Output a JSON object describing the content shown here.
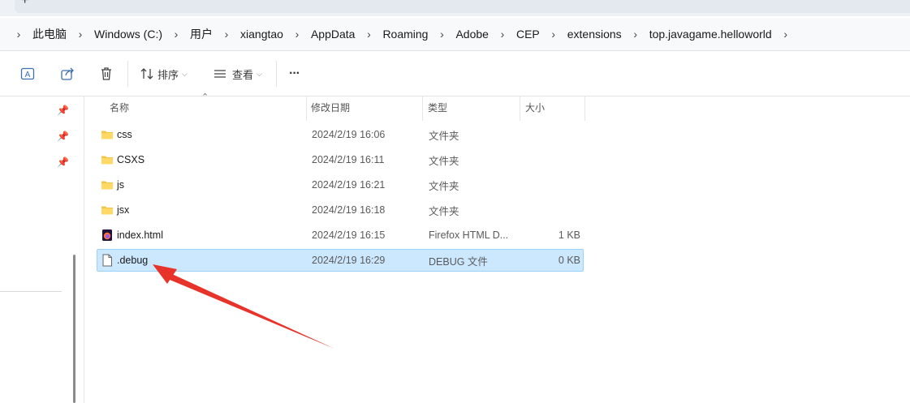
{
  "tabbar": {
    "new_tab_glyph": "+"
  },
  "breadcrumb": {
    "items": [
      "此电脑",
      "Windows (C:)",
      "用户",
      "xiangtao",
      "AppData",
      "Roaming",
      "Adobe",
      "CEP",
      "extensions",
      "top.javagame.helloworld"
    ]
  },
  "toolbar": {
    "sort_label": "排序",
    "view_label": "查看",
    "more_label": "···"
  },
  "columns": {
    "name": "名称",
    "date": "修改日期",
    "type": "类型",
    "size": "大小"
  },
  "files": [
    {
      "name": "css",
      "date": "2024/2/19 16:06",
      "type": "文件夹",
      "size": "",
      "icon": "folder-icon"
    },
    {
      "name": "CSXS",
      "date": "2024/2/19 16:11",
      "type": "文件夹",
      "size": "",
      "icon": "folder-icon"
    },
    {
      "name": "js",
      "date": "2024/2/19 16:21",
      "type": "文件夹",
      "size": "",
      "icon": "folder-icon"
    },
    {
      "name": "jsx",
      "date": "2024/2/19 16:18",
      "type": "文件夹",
      "size": "",
      "icon": "folder-icon"
    },
    {
      "name": "index.html",
      "date": "2024/2/19 16:15",
      "type": "Firefox HTML D...",
      "size": "1 KB",
      "icon": "firefox-html-icon"
    },
    {
      "name": ".debug",
      "date": "2024/2/19 16:29",
      "type": "DEBUG 文件",
      "size": "0 KB",
      "icon": "blank-file-icon",
      "selected": true
    }
  ],
  "colors": {
    "selection": "#cce8ff",
    "selection_border": "#99d1ff",
    "folder": "#f6c443",
    "annotation_arrow": "#e8332a"
  }
}
